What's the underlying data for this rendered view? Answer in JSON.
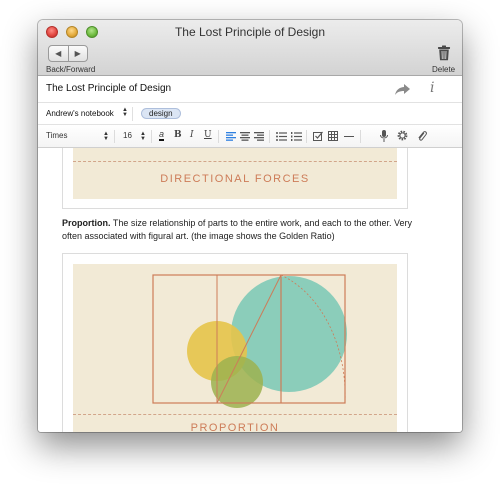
{
  "window": {
    "title": "The Lost Principle of Design"
  },
  "toolbar": {
    "nav_label": "Back/Forward",
    "back_glyph": "◀",
    "forward_glyph": "▶",
    "delete_label": "Delete"
  },
  "note": {
    "title": "The Lost Principle of Design",
    "notebook": "Andrew's notebook",
    "tag": "design"
  },
  "format": {
    "font": "Times",
    "size": "16",
    "text_color_glyph": "a",
    "bold": "B",
    "italic": "I",
    "underline": "U"
  },
  "body": {
    "figure1_label": "DIRECTIONAL FORCES",
    "paragraph_bold": "Proportion.",
    "paragraph_text": " The size relationship of parts to the entire work, and each to the other. Very often associated with figural art. (the image shows the Golden Ratio)",
    "figure2_label": "PROPORTION"
  },
  "colors": {
    "poster_bg": "#f2ead6",
    "accent_rust": "#cd7c58",
    "circle_teal": "#7fcab7",
    "circle_yellow": "#e6c44a",
    "circle_olive": "#9cb14f",
    "tag_bg": "#dbe5f4"
  },
  "icons": [
    "close-button",
    "minimize-button",
    "zoom-button",
    "back-icon",
    "forward-icon",
    "trash-icon",
    "share-icon",
    "info-icon",
    "align-left-icon",
    "align-center-icon",
    "align-right-icon",
    "bullet-list-icon",
    "numbered-list-icon",
    "checkbox-icon",
    "table-icon",
    "horizontal-rule-icon",
    "microphone-icon",
    "gear-icon",
    "paperclip-icon"
  ]
}
